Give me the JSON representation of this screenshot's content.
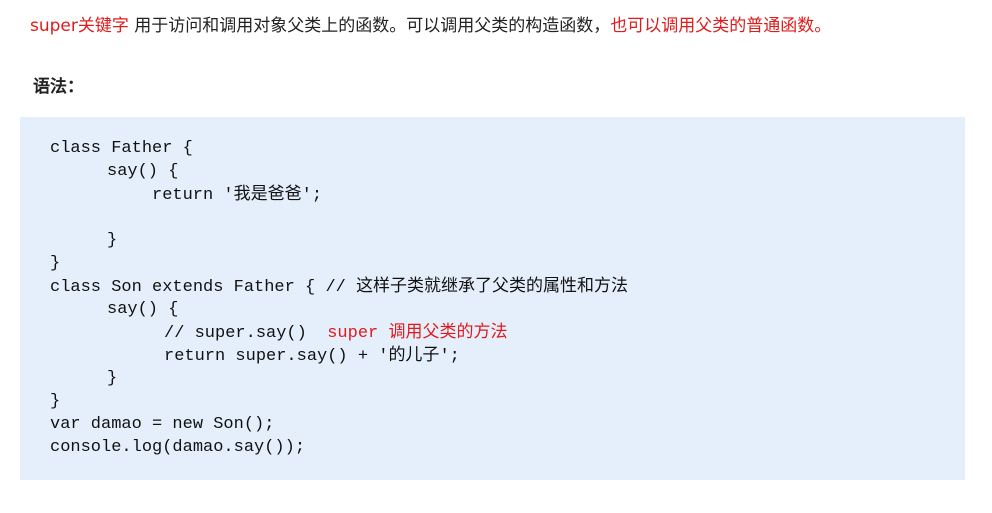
{
  "intro": {
    "keyword": "super关键字",
    "text": " 用于访问和调用对象父类上的函数。可以调用父类的构造函数，",
    "highlight": "也可以调用父类的普通函数。"
  },
  "syntax_heading": "语法：",
  "code": {
    "l1": "class Father {",
    "l2": "say() {",
    "l3_kw": "return '",
    "l3_str": "我是爸爸",
    "l3_end": "';",
    "l4": "}",
    "l5": "}",
    "l6_code": "class Son extends Father { // ",
    "l6_comment": "这样子类就继承了父类的属性和方法",
    "l7": "say() {",
    "l8_code": "// super.say()",
    "l8_super": "super",
    "l8_note": "调用父类的方法",
    "l9_code": "return super.say() + '",
    "l9_str": "的儿子",
    "l9_end": "';",
    "l10": "}",
    "l11": "}",
    "l12": "var damao = new Son();",
    "l13": "console.log(damao.say());"
  },
  "colors": {
    "accent_red": "#e01b1b",
    "code_background": "#e5effc"
  }
}
